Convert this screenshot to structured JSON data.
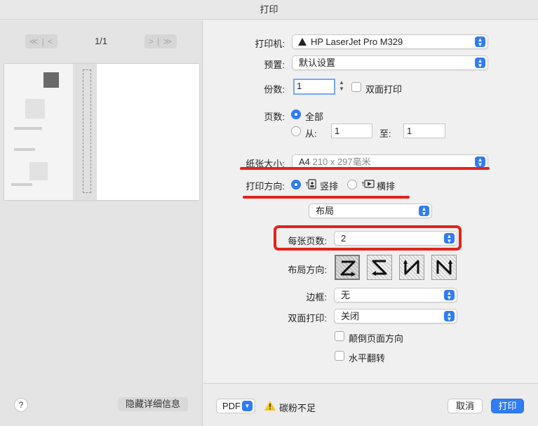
{
  "window": {
    "title": "打印"
  },
  "preview": {
    "prev_label": "≪ | <",
    "next_label": "> | ≫",
    "page_counter": "1/1",
    "hide_details_label": "隐藏详细信息",
    "help_label": "?"
  },
  "form": {
    "printer_label": "打印机:",
    "printer_value": "HP LaserJet Pro M329",
    "presets_label": "预置:",
    "presets_value": "默认设置",
    "copies_label": "份数:",
    "copies_value": "1",
    "duplex_check_label": "双面打印",
    "pages_label": "页数:",
    "pages_all_label": "全部",
    "pages_from_label": "从:",
    "pages_from_value": "1",
    "pages_to_label": "至:",
    "pages_to_value": "1",
    "paper_label": "纸张大小:",
    "paper_value": "A4",
    "paper_dim": "210 x 297毫米",
    "orientation_label": "打印方向:",
    "portrait_label": "竖排",
    "landscape_label": "横排",
    "section_value": "布局",
    "pages_per_sheet_label": "每张页数:",
    "pages_per_sheet_value": "2",
    "layout_direction_label": "布局方向:",
    "border_label": "边框:",
    "border_value": "无",
    "two_sided_label": "双面打印:",
    "two_sided_value": "关闭",
    "reverse_orientation_label": "颠倒页面方向",
    "flip_horizontal_label": "水平翻转"
  },
  "footer": {
    "pdf_label": "PDF",
    "toner_warning": "碳粉不足",
    "cancel_label": "取消",
    "print_label": "打印"
  },
  "icons": {
    "printer": "printer-icon",
    "warning": "warning-icon",
    "portrait": "portrait-orientation-icon",
    "landscape": "landscape-orientation-icon"
  },
  "colors": {
    "accent": "#2f7cf6",
    "annotation_red": "#e4231a",
    "warning": "#f5c518"
  }
}
